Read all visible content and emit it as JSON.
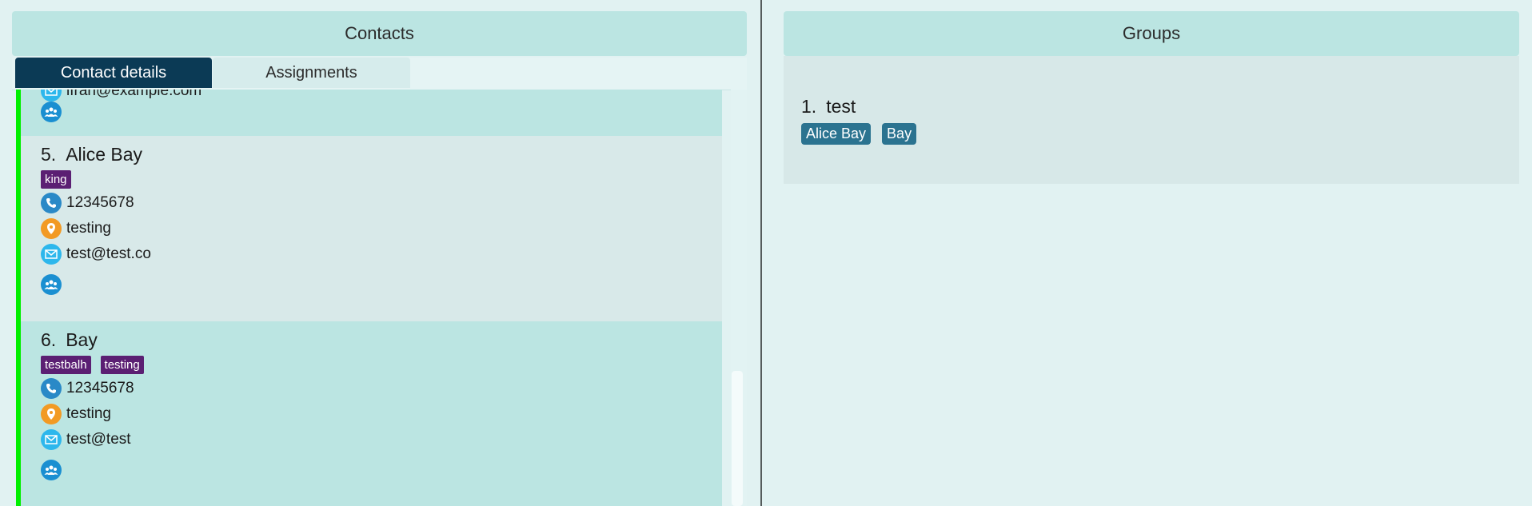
{
  "contacts_panel": {
    "title": "Contacts",
    "tabs": [
      {
        "label": "Contact details",
        "active": true
      },
      {
        "label": "Assignments",
        "active": false
      }
    ],
    "cards": [
      {
        "index": "",
        "name": "",
        "tags": [],
        "email_partial": "ifran@example.com"
      },
      {
        "index": "5.",
        "name": "Alice Bay",
        "tags": [
          "king"
        ],
        "phone": "12345678",
        "address": "testing",
        "email": "test@test.co"
      },
      {
        "index": "6.",
        "name": "Bay",
        "tags": [
          "testbalh",
          "testing"
        ],
        "phone": "12345678",
        "address": "testing",
        "email": "test@test"
      }
    ]
  },
  "groups_panel": {
    "title": "Groups",
    "groups": [
      {
        "index": "1.",
        "name": "test",
        "members": [
          "Alice Bay",
          "Bay"
        ]
      }
    ]
  },
  "colors": {
    "accent_bar": "#00f000",
    "tab_active": "#0b3a55",
    "tag": "#5b1f73",
    "member_chip": "#2b7390",
    "header": "#bbe5e2"
  },
  "icons": {
    "phone": "phone-icon",
    "address": "location-pin-icon",
    "email": "mail-icon",
    "groups": "group-icon"
  }
}
